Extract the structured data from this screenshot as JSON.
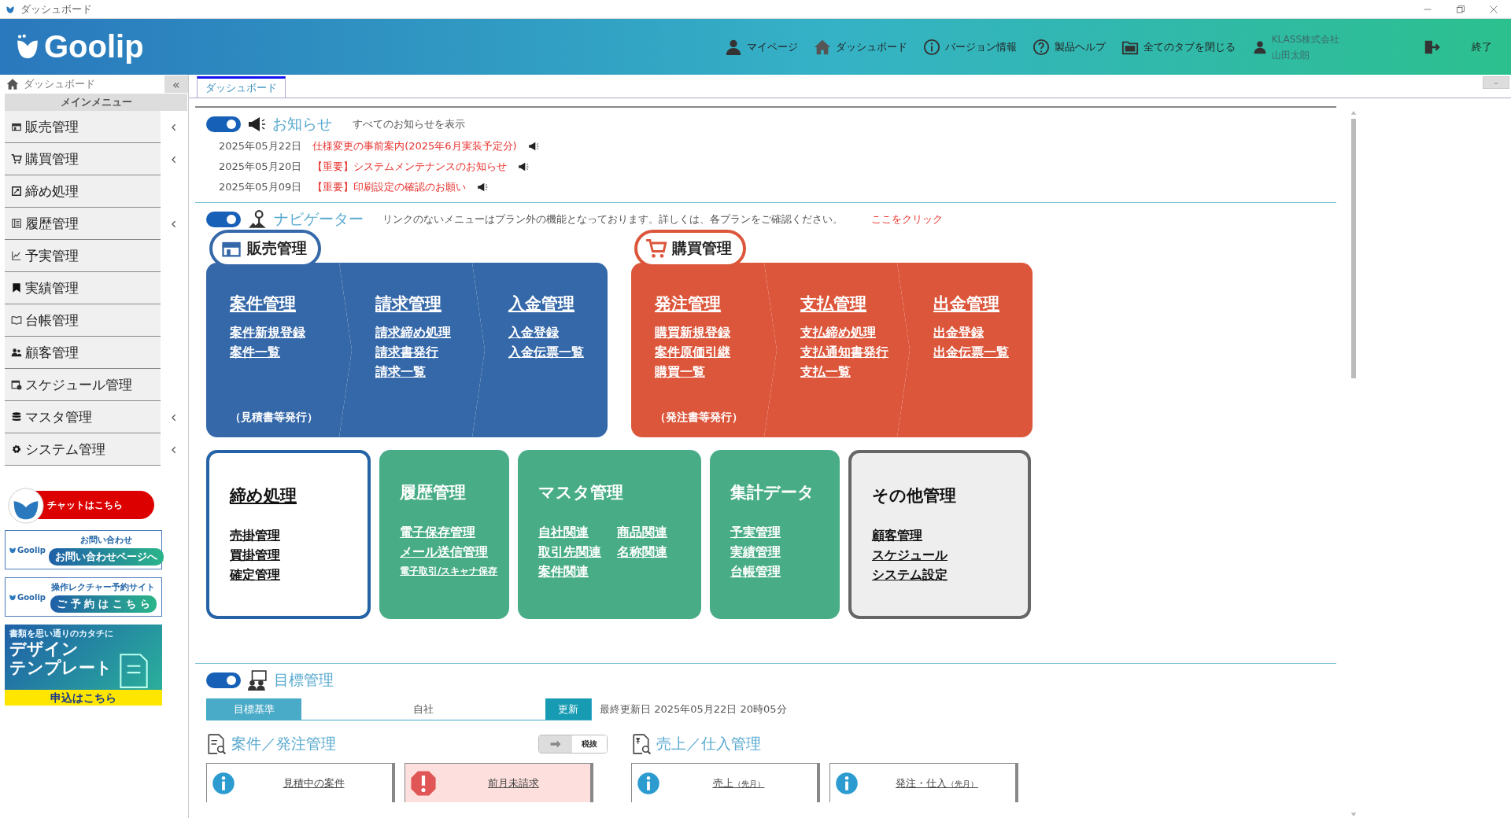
{
  "window": {
    "title": "ダッシュボード"
  },
  "header": {
    "logo": "Goolip",
    "nav": [
      {
        "kind": "person",
        "label": "マイページ"
      },
      {
        "kind": "home",
        "label": "ダッシュボード"
      },
      {
        "kind": "info",
        "label": "バージョン情報"
      },
      {
        "kind": "help",
        "label": "製品ヘルプ"
      },
      {
        "kind": "folder",
        "label": "全てのタブを閉じる"
      }
    ],
    "user": {
      "company": "KLASS株式会社",
      "name": "山田太朗"
    },
    "exit": "終了"
  },
  "sidebar": {
    "tab": "ダッシュボード",
    "collapse": "«",
    "menu_title": "メインメニュー",
    "items": [
      {
        "kind": "shop",
        "label": "販売管理",
        "has_submenu": true
      },
      {
        "kind": "cart",
        "label": "購買管理",
        "has_submenu": true
      },
      {
        "kind": "check",
        "label": "締め処理",
        "has_submenu": false
      },
      {
        "kind": "list",
        "label": "履歴管理",
        "has_submenu": true
      },
      {
        "kind": "chart",
        "label": "予実管理",
        "has_submenu": false
      },
      {
        "kind": "bookmark",
        "label": "実績管理",
        "has_submenu": false
      },
      {
        "kind": "book",
        "label": "台帳管理",
        "has_submenu": false
      },
      {
        "kind": "people",
        "label": "顧客管理",
        "has_submenu": false
      },
      {
        "kind": "calendar",
        "label": "スケジュール管理",
        "has_submenu": false
      },
      {
        "kind": "database",
        "label": "マスタ管理",
        "has_submenu": true
      },
      {
        "kind": "gear",
        "label": "システム管理",
        "has_submenu": true
      }
    ],
    "banners": [
      {
        "kind": "chat",
        "button": "チャットはこちら"
      },
      {
        "kind": "site",
        "logo": "Goolip",
        "title": "お問い合わせ",
        "button": "お問い合わせページへ"
      },
      {
        "kind": "site",
        "logo": "Goolip",
        "title": "操作レクチャー予約サイト",
        "button": "ご 予 約 は こ ち ら"
      },
      {
        "kind": "design",
        "tagline": "書類を思い通りのカタチに",
        "title_lines": [
          "デザイン",
          "テンプレート"
        ],
        "button": "申込はこちら"
      }
    ]
  },
  "tabs": [
    {
      "label": "ダッシュボード",
      "selected": true
    }
  ],
  "notices": {
    "on": true,
    "title": "お知らせ",
    "link": "すべてのお知らせを表示",
    "items": [
      {
        "date": "2025年05月22日",
        "text": "仕様変更の事前案内(2025年6月実装予定分)"
      },
      {
        "date": "2025年05月20日",
        "text": "【重要】システムメンテナンスのお知らせ"
      },
      {
        "date": "2025年05月09日",
        "text": "【重要】印刷設定の確認のお願い"
      }
    ]
  },
  "navigator": {
    "on": true,
    "title": "ナビゲーター",
    "note": "リンクのないメニューはプラン外の機能となっております。詳しくは、各プランをご確認ください。",
    "link": "ここをクリック",
    "flows": [
      {
        "kind": "shop",
        "label": "販売管理",
        "color": "#3568a8",
        "tiles": [
          {
            "title": "案件管理",
            "links": [
              "案件新規登録",
              "案件一覧"
            ],
            "footnote": "（見積書等発行）"
          },
          {
            "title": "請求管理",
            "links": [
              "請求締め処理",
              "請求書発行",
              "請求一覧"
            ]
          },
          {
            "title": "入金管理",
            "links": [
              "入金登録",
              "入金伝票一覧"
            ]
          }
        ]
      },
      {
        "kind": "cart",
        "label": "購買管理",
        "color": "#dc563b",
        "tiles": [
          {
            "title": "発注管理",
            "links": [
              "購買新規登録",
              "案件原価引継",
              "購買一覧"
            ],
            "footnote": "（発注書等発行）"
          },
          {
            "title": "支払管理",
            "links": [
              "支払締め処理",
              "支払通知書発行",
              "支払一覧"
            ]
          },
          {
            "title": "出金管理",
            "links": [
              "出金登録",
              "出金伝票一覧"
            ]
          }
        ]
      }
    ],
    "boxes": [
      {
        "kind": "outline",
        "title": "締め処理",
        "title_link": true,
        "columns": [
          [
            "売掛管理",
            "買掛管理",
            "確定管理"
          ]
        ]
      },
      {
        "kind": "green",
        "title": "履歴管理",
        "title_link": false,
        "columns": [
          [
            "電子保存管理",
            "メール送信管理"
          ]
        ],
        "small_links": [
          "電子取引/スキャナ保存"
        ]
      },
      {
        "kind": "green",
        "title": "マスタ管理",
        "title_link": false,
        "columns": [
          [
            "自社関連",
            "取引先関連",
            "案件関連"
          ],
          [
            "商品関連",
            "名称関連"
          ]
        ]
      },
      {
        "kind": "green",
        "title": "集計データ",
        "title_link": false,
        "columns": [
          [
            "予実管理",
            "実績管理",
            "台帳管理"
          ]
        ]
      },
      {
        "kind": "grey",
        "title": "その他管理",
        "title_link": false,
        "columns": [
          [
            "顧客管理",
            "スケジュール",
            "システム設定"
          ]
        ]
      }
    ]
  },
  "goals": {
    "on": true,
    "title": "目標管理",
    "basis_label": "目標基準",
    "basis_value": "自社",
    "update": "更新",
    "last_updated": "最終更新日 2025年05月22日 20時05分"
  },
  "sections": [
    {
      "kind": "search-doc",
      "title": "案件／発注管理",
      "tax_toggle": "税抜",
      "cards": [
        {
          "kind": "info",
          "label": "見積中の案件"
        },
        {
          "kind": "alert",
          "label": "前月未請求"
        }
      ]
    },
    {
      "kind": "yen-doc",
      "title": "売上／仕入管理",
      "cards": [
        {
          "kind": "info",
          "label": "売上",
          "suffix": "（先月）"
        },
        {
          "kind": "info",
          "label": "発注・仕入",
          "suffix": "（先月）"
        }
      ]
    }
  ]
}
